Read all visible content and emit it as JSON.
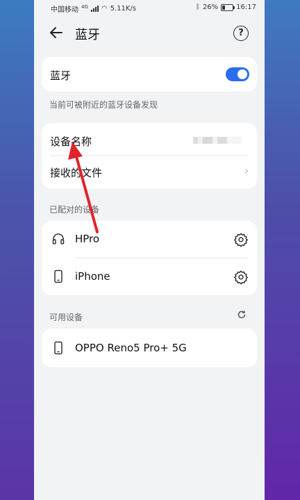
{
  "status": {
    "carrier": "中国移动",
    "network": "4G",
    "speed": "5.11K/s",
    "battery": "26%",
    "time": "16:17"
  },
  "header": {
    "title": "蓝牙"
  },
  "bluetooth": {
    "label": "蓝牙",
    "enabled": true
  },
  "visibility_note": "当前可被附近的蓝牙设备发现",
  "device": {
    "name_label": "设备名称",
    "received_files_label": "接收的文件"
  },
  "paired": {
    "title": "已配对的设备",
    "items": [
      {
        "name": "HPro",
        "icon": "headphones-icon"
      },
      {
        "name": "iPhone",
        "icon": "phone-icon"
      }
    ]
  },
  "available": {
    "title": "可用设备",
    "items": [
      {
        "name": "OPPO Reno5 Pro+ 5G",
        "icon": "phone-icon"
      }
    ]
  },
  "colors": {
    "accent": "#2b6cf0",
    "annotation_arrow": "#e0242a"
  }
}
